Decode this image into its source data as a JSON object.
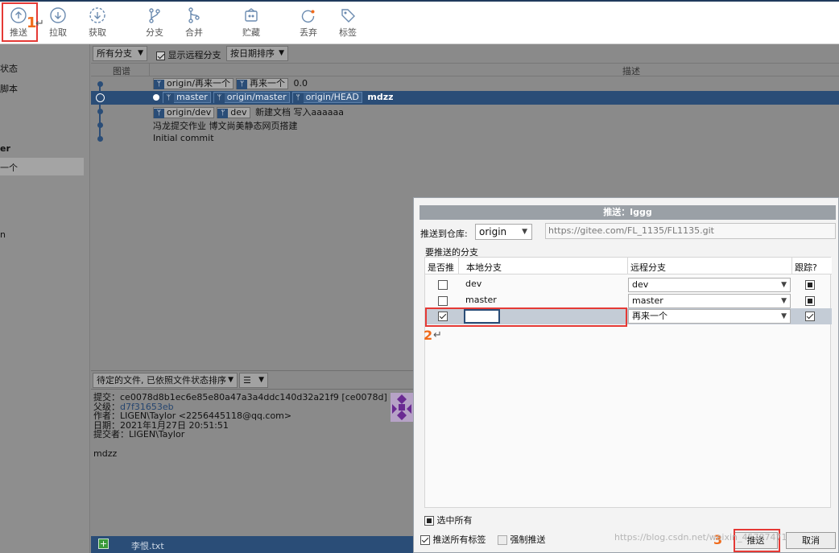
{
  "toolbar": {
    "items": [
      {
        "label": "推送",
        "icon": "push-icon"
      },
      {
        "label": "拉取",
        "icon": "pull-icon"
      },
      {
        "label": "获取",
        "icon": "fetch-icon"
      },
      {
        "label": "分支",
        "icon": "branch-icon"
      },
      {
        "label": "合并",
        "icon": "merge-icon"
      },
      {
        "label": "贮藏",
        "icon": "stash-icon"
      },
      {
        "label": "丢弃",
        "icon": "discard-icon"
      },
      {
        "label": "标签",
        "icon": "tag-icon"
      }
    ]
  },
  "annotations": {
    "step1": "1",
    "step2": "2",
    "step3": "3"
  },
  "sidebar": {
    "items": [
      "状态",
      "脚本",
      "er",
      "一个",
      "n"
    ]
  },
  "history": {
    "branch_filter": "所有分支",
    "show_remote_label": "显示远程分支",
    "sort_label": "按日期排序",
    "col_graph": "图谱",
    "col_desc": "描述",
    "commits": [
      {
        "refs": [
          "origin/再来一个",
          "再来一个"
        ],
        "message": "0.0"
      },
      {
        "refs": [
          "master",
          "origin/master",
          "origin/HEAD"
        ],
        "message": "mdzz"
      },
      {
        "refs": [
          "origin/dev",
          "dev"
        ],
        "message": "新建文档  写入aaaaaa"
      },
      {
        "refs": [],
        "message": "冯龙提交作业  博文尚美静态网页搭建"
      },
      {
        "refs": [],
        "message": "Initial commit"
      }
    ]
  },
  "lower": {
    "file_filter": "待定的文件, 已依照文件状态排序",
    "view_icon": "list-icon",
    "commit_label": "提交：",
    "commit_value": "ce0078d8b1ec6e85e80a47a3a4ddc140d32a21f9 [ce0078d]",
    "parent_label": "父级：",
    "parent_value": "d7f31653eb",
    "author_label": "作者：",
    "author_value": "LIGEN\\Taylor <2256445118@qq.com>",
    "date_label": "日期：",
    "date_value": "2021年1月27日 20:51:51",
    "committer_label": "提交者：",
    "committer_value": "LIGEN\\Taylor",
    "message": "mdzz",
    "file_name": "李恨.txt"
  },
  "dialog": {
    "title": "推送：lggg",
    "repo_label": "推送到仓库:",
    "repo_value": "origin",
    "repo_url": "https://gitee.com/FL_1135/FL1135.git",
    "branches_label": "要推送的分支",
    "col_push": "是否推",
    "col_local": "本地分支",
    "col_remote": "远程分支",
    "col_track": "跟踪?",
    "rows": [
      {
        "push": false,
        "local": "dev",
        "remote": "dev",
        "track": "indeterminate"
      },
      {
        "push": false,
        "local": "master",
        "remote": "master",
        "track": "indeterminate"
      },
      {
        "push": true,
        "local": "",
        "remote": "再来一个",
        "track": "checked"
      }
    ],
    "select_all": "选中所有",
    "push_all_tags": "推送所有标签",
    "force_push": "强制推送",
    "ok_button": "推送",
    "cancel_button": "取消"
  },
  "watermark": "https://blog.csdn.net/weixin_45787471"
}
